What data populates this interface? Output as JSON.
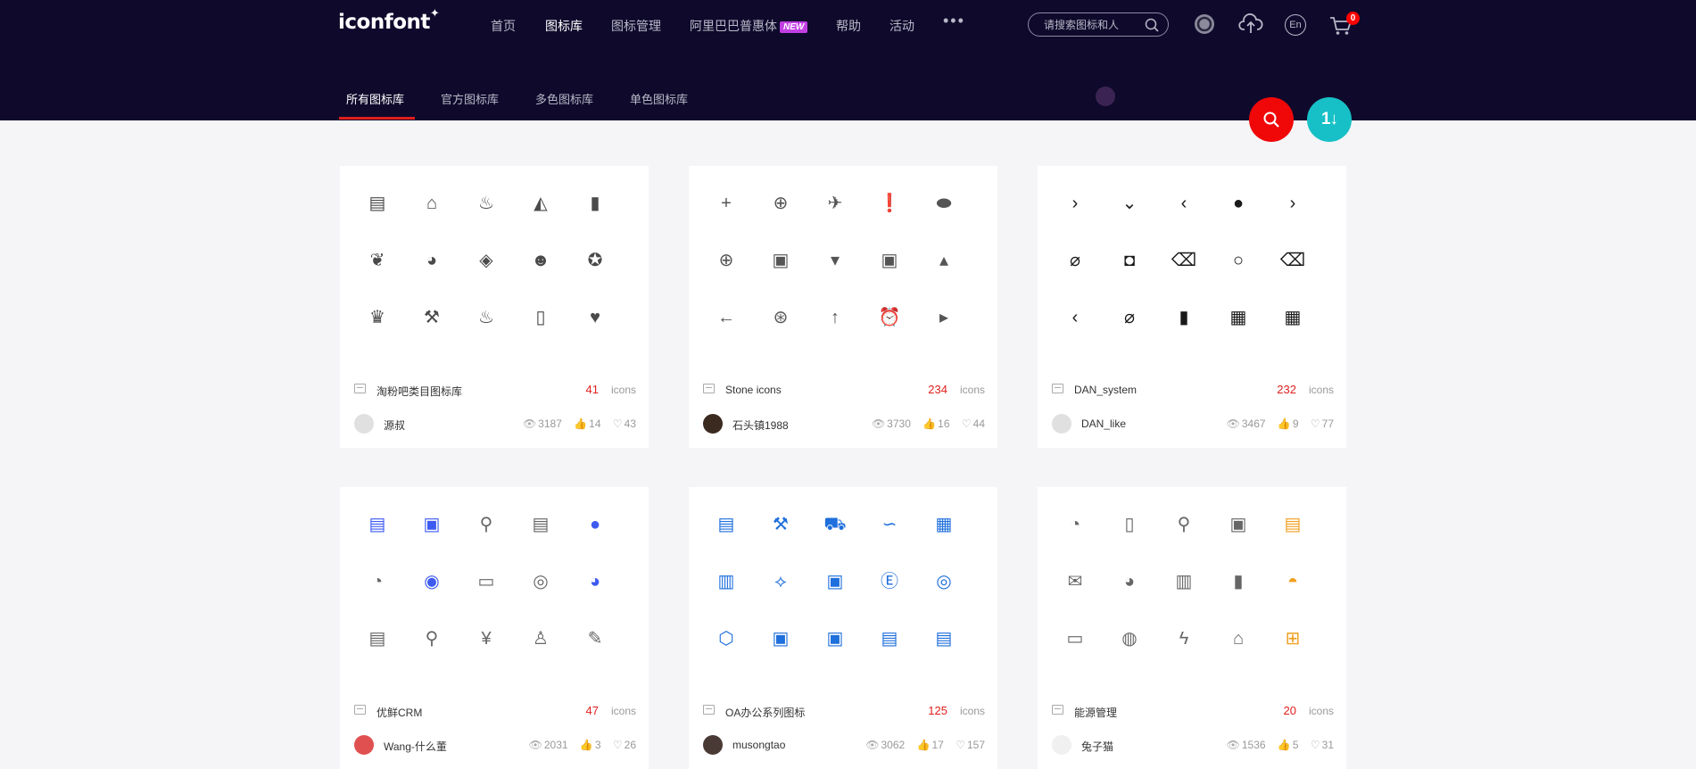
{
  "header": {
    "logo": "iconfont",
    "logo_mark": "✦",
    "nav": [
      {
        "label": "首页",
        "active": false
      },
      {
        "label": "图标库",
        "active": true
      },
      {
        "label": "图标管理",
        "active": false
      },
      {
        "label": "阿里巴巴普惠体",
        "active": false,
        "badge": "NEW"
      },
      {
        "label": "帮助",
        "active": false
      },
      {
        "label": "活动",
        "active": false
      }
    ],
    "more": "•••",
    "search_placeholder": "请搜索图标和人",
    "lang": "En",
    "cart_count": "0"
  },
  "subnav": {
    "tabs": [
      {
        "label": "所有图标库",
        "active": true
      },
      {
        "label": "官方图标库",
        "active": false
      },
      {
        "label": "多色图标库",
        "active": false
      },
      {
        "label": "单色图标库",
        "active": false
      }
    ]
  },
  "fab": {
    "sort_label": "1↓"
  },
  "cards": [
    {
      "title": "淘粉吧类目图标库",
      "count": "41",
      "count_label": "icons",
      "author": "源叔",
      "views": "3187",
      "likes": "14",
      "favorites": "43",
      "icon_color": "#4a4a4a",
      "icons": [
        "card-stack",
        "storefront",
        "pot",
        "cup",
        "lipstick",
        "plant",
        "duck",
        "tag",
        "baby-face",
        "star-badge",
        "crown",
        "tools",
        "flame",
        "tablet",
        "strawberry"
      ]
    },
    {
      "title": "Stone icons",
      "count": "234",
      "count_label": "icons",
      "author": "石头镇1988",
      "views": "3730",
      "likes": "16",
      "favorites": "44",
      "icon_color": "#555555",
      "icons": [
        "plus",
        "plus-circle",
        "airplane",
        "alert-circle",
        "football",
        "plus-filled",
        "shopping-bag",
        "caret-down",
        "archive",
        "caret-up",
        "arrow-left",
        "aperture",
        "arrow-up",
        "alarm-clock",
        "caret-right"
      ]
    },
    {
      "title": "DAN_system",
      "count": "232",
      "count_label": "icons",
      "author": "DAN_like",
      "views": "3467",
      "likes": "9",
      "favorites": "77",
      "icon_color": "#1a1a1a",
      "icons": [
        "chevron-right",
        "chevron-down",
        "chevron-left",
        "apple",
        "chevron-right",
        "paperclip",
        "android",
        "backspace",
        "apple-outline",
        "backspace-filled",
        "chevron-left",
        "paperclip",
        "file",
        "basket",
        "basket-outline"
      ]
    },
    {
      "title": "优鲜CRM",
      "count": "47",
      "count_label": "icons",
      "author": "Wang-什么董",
      "views": "2031",
      "likes": "3",
      "favorites": "26",
      "icon_color": "#666666",
      "accent_color": "#3d5af1",
      "icons": [
        "clipboard",
        "monitor-chart",
        "person",
        "notepad",
        "person-filled",
        "money-bag",
        "user-circle",
        "monitor-line",
        "user-circle-outline",
        "money-bag-filled",
        "document",
        "search",
        "yuan-shield",
        "person-money",
        "note-edit"
      ]
    },
    {
      "title": "OA办公系列图标",
      "count": "125",
      "count_label": "icons",
      "author": "musongtao",
      "views": "3062",
      "likes": "17",
      "favorites": "157",
      "icon_color": "#1f6fdc",
      "icons": [
        "form-user",
        "hammer",
        "truck",
        "route",
        "form-grid",
        "book-chart",
        "workflow",
        "calendar-temp",
        "ed-badge",
        "lifebuoy",
        "cubes",
        "id-card-user",
        "id-card-add",
        "clipboard-upload",
        "form-lock"
      ]
    },
    {
      "title": "能源管理",
      "count": "20",
      "count_label": "icons",
      "author": "兔子猫",
      "views": "1536",
      "likes": "5",
      "favorites": "31",
      "icon_color": "#666666",
      "accent_color": "#f0a020",
      "icons": [
        "gauge",
        "doc-bolt",
        "user-settings",
        "doc-search",
        "notepad-lines",
        "mail-open",
        "pie-chart",
        "sliders",
        "bar-chart",
        "water-drop",
        "battery",
        "bulb",
        "lightning",
        "house-lock",
        "network"
      ]
    }
  ]
}
